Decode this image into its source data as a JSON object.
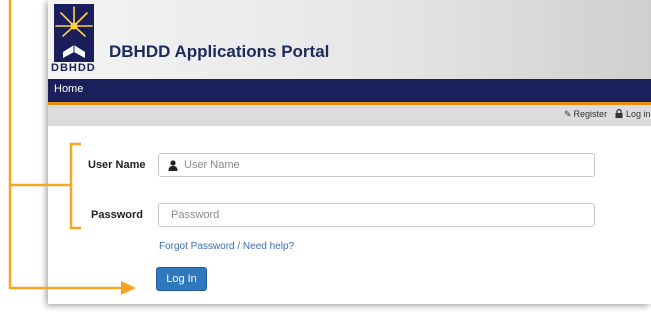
{
  "header": {
    "logo_text": "DBHDD",
    "title": "DBHDD Applications Portal"
  },
  "nav": {
    "home": "Home"
  },
  "utility": {
    "register": "Register",
    "login": "Log in"
  },
  "form": {
    "username_label": "User Name",
    "username_placeholder": "User Name",
    "password_label": "Password",
    "password_placeholder": "Password",
    "forgot": "Forgot Password / Need help?",
    "submit": "Log In"
  },
  "colors": {
    "nav_bg": "#1b1f5c",
    "accent_orange": "#e8900f",
    "button_blue": "#2f78bd",
    "link_blue": "#3a6fb0"
  },
  "icons": {
    "logo": "sunburst-book-icon",
    "register": "pencil-icon",
    "login": "lock-icon",
    "username": "user-icon"
  }
}
